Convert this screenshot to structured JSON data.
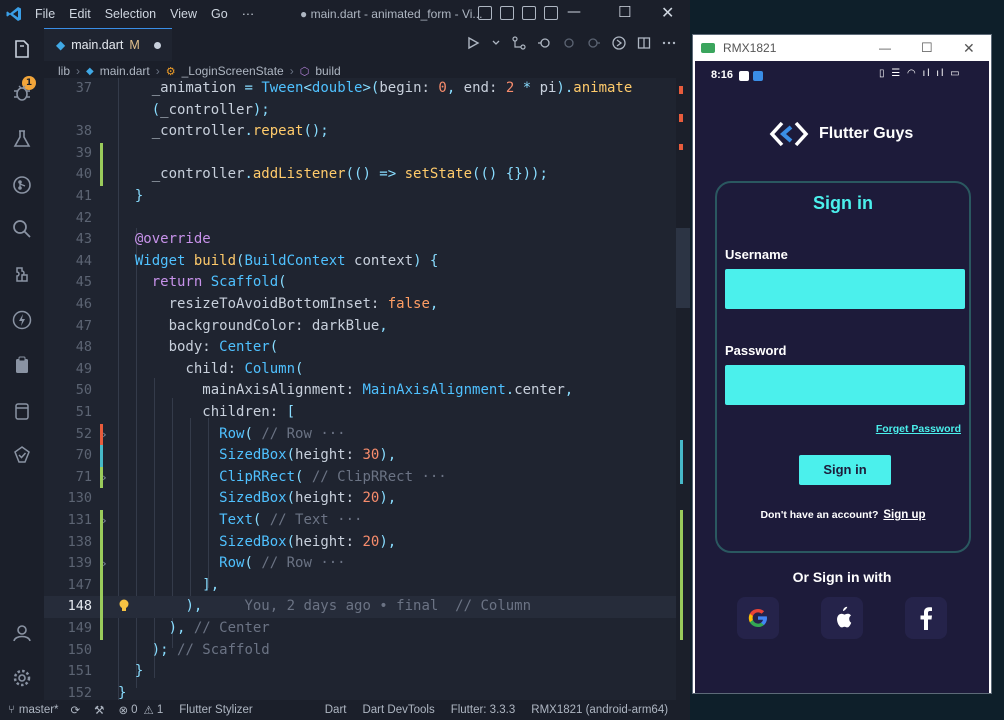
{
  "vscode": {
    "menu": [
      "File",
      "Edit",
      "Selection",
      "View",
      "Go",
      "···"
    ],
    "window_title": "● main.dart - animated_form - Vi...",
    "tab": {
      "name": "main.dart",
      "status": "M"
    },
    "breadcrumb": [
      "lib",
      "main.dart",
      "_LoginScreenState",
      "build"
    ],
    "blame_hint": "You, 2 days ago • final",
    "blame_comment": "// Column",
    "status": {
      "branch": "master*",
      "errors": "0",
      "warnings": "1",
      "stylizer": "Flutter Stylizer",
      "language": "Dart",
      "devtools": "Dart DevTools",
      "flutter": "Flutter: 3.3.3",
      "device": "RMX1821 (android-arm64)"
    },
    "lines": [
      {
        "n": "37",
        "tokens": [
          [
            "",
            "    "
          ],
          [
            "prop",
            "_animation"
          ],
          [
            "p",
            " = "
          ],
          [
            "t",
            "Tween"
          ],
          [
            "p",
            "<"
          ],
          [
            "t",
            "double"
          ],
          [
            "p",
            ">"
          ],
          [
            "p",
            "("
          ],
          [
            "prop",
            "begin: "
          ],
          [
            "n",
            "0"
          ],
          [
            "p",
            ", "
          ],
          [
            "prop",
            "end: "
          ],
          [
            "n",
            "2"
          ],
          [
            "p",
            " * "
          ],
          [
            "prop",
            "pi"
          ],
          [
            "p",
            ")."
          ],
          [
            "f",
            "animate"
          ]
        ]
      },
      {
        "n": "",
        "tokens": [
          [
            "",
            "    "
          ],
          [
            "p",
            "("
          ],
          [
            "prop",
            "_controller"
          ],
          [
            "p",
            ");"
          ]
        ]
      },
      {
        "n": "38",
        "tokens": [
          [
            "",
            "    "
          ],
          [
            "prop",
            "_controller"
          ],
          [
            "p",
            "."
          ],
          [
            "f",
            "repeat"
          ],
          [
            "p",
            "();"
          ]
        ]
      },
      {
        "n": "39",
        "tokens": []
      },
      {
        "n": "40",
        "tokens": [
          [
            "",
            "    "
          ],
          [
            "prop",
            "_controller"
          ],
          [
            "p",
            "."
          ],
          [
            "f",
            "addListener"
          ],
          [
            "p",
            "(() => "
          ],
          [
            "f",
            "setState"
          ],
          [
            "p",
            "(() {}));"
          ]
        ]
      },
      {
        "n": "41",
        "tokens": [
          [
            "",
            "  "
          ],
          [
            "p",
            "}"
          ]
        ]
      },
      {
        "n": "42",
        "tokens": []
      },
      {
        "n": "43",
        "tokens": [
          [
            "",
            "  "
          ],
          [
            "k",
            "@override"
          ]
        ]
      },
      {
        "n": "44",
        "tokens": [
          [
            "",
            "  "
          ],
          [
            "t",
            "Widget"
          ],
          [
            "prop",
            " "
          ],
          [
            "f",
            "build"
          ],
          [
            "p",
            "("
          ],
          [
            "t",
            "BuildContext"
          ],
          [
            "prop",
            " context"
          ],
          [
            "p",
            ") {"
          ]
        ]
      },
      {
        "n": "45",
        "tokens": [
          [
            "",
            "    "
          ],
          [
            "k",
            "return"
          ],
          [
            "prop",
            " "
          ],
          [
            "t",
            "Scaffold"
          ],
          [
            "p",
            "("
          ]
        ]
      },
      {
        "n": "46",
        "tokens": [
          [
            "",
            "      "
          ],
          [
            "prop",
            "resizeToAvoidBottomInset: "
          ],
          [
            "kw",
            "false"
          ],
          [
            "p",
            ","
          ]
        ]
      },
      {
        "n": "47",
        "tokens": [
          [
            "",
            "      "
          ],
          [
            "prop",
            "backgroundColor: darkBlue"
          ],
          [
            "p",
            ","
          ]
        ]
      },
      {
        "n": "48",
        "tokens": [
          [
            "",
            "      "
          ],
          [
            "prop",
            "body: "
          ],
          [
            "t",
            "Center"
          ],
          [
            "p",
            "("
          ]
        ]
      },
      {
        "n": "49",
        "tokens": [
          [
            "",
            "        "
          ],
          [
            "prop",
            "child: "
          ],
          [
            "t",
            "Column"
          ],
          [
            "p",
            "("
          ]
        ]
      },
      {
        "n": "50",
        "tokens": [
          [
            "",
            "          "
          ],
          [
            "prop",
            "mainAxisAlignment: "
          ],
          [
            "t",
            "MainAxisAlignment"
          ],
          [
            "p",
            "."
          ],
          [
            "prop",
            "center"
          ],
          [
            "p",
            ","
          ]
        ]
      },
      {
        "n": "51",
        "tokens": [
          [
            "",
            "          "
          ],
          [
            "prop",
            "children: "
          ],
          [
            "p",
            "["
          ]
        ]
      },
      {
        "n": "52",
        "fold": true,
        "tokens": [
          [
            "",
            "            "
          ],
          [
            "t",
            "Row"
          ],
          [
            "p",
            "( "
          ],
          [
            "c",
            "// Row ···"
          ]
        ]
      },
      {
        "n": "70",
        "tokens": [
          [
            "",
            "            "
          ],
          [
            "t",
            "SizedBox"
          ],
          [
            "p",
            "("
          ],
          [
            "prop",
            "height: "
          ],
          [
            "n",
            "30"
          ],
          [
            "p",
            "),"
          ]
        ]
      },
      {
        "n": "71",
        "fold": true,
        "tokens": [
          [
            "",
            "            "
          ],
          [
            "t",
            "ClipRRect"
          ],
          [
            "p",
            "( "
          ],
          [
            "c",
            "// ClipRRect ···"
          ]
        ]
      },
      {
        "n": "130",
        "tokens": [
          [
            "",
            "            "
          ],
          [
            "t",
            "SizedBox"
          ],
          [
            "p",
            "("
          ],
          [
            "prop",
            "height: "
          ],
          [
            "n",
            "20"
          ],
          [
            "p",
            "),"
          ]
        ]
      },
      {
        "n": "131",
        "fold": true,
        "tokens": [
          [
            "",
            "            "
          ],
          [
            "t",
            "Text"
          ],
          [
            "p",
            "( "
          ],
          [
            "c",
            "// Text ···"
          ]
        ]
      },
      {
        "n": "138",
        "tokens": [
          [
            "",
            "            "
          ],
          [
            "t",
            "SizedBox"
          ],
          [
            "p",
            "("
          ],
          [
            "prop",
            "height: "
          ],
          [
            "n",
            "20"
          ],
          [
            "p",
            "),"
          ]
        ]
      },
      {
        "n": "139",
        "fold": true,
        "tokens": [
          [
            "",
            "            "
          ],
          [
            "t",
            "Row"
          ],
          [
            "p",
            "( "
          ],
          [
            "c",
            "// Row ···"
          ]
        ]
      },
      {
        "n": "147",
        "tokens": [
          [
            "",
            "          "
          ],
          [
            "p",
            "],"
          ]
        ]
      },
      {
        "n": "148",
        "current": true,
        "tokens": [
          [
            "",
            "        "
          ],
          [
            "p",
            "),"
          ]
        ]
      },
      {
        "n": "149",
        "tokens": [
          [
            "",
            "      "
          ],
          [
            "p",
            "), "
          ],
          [
            "c",
            "// Center"
          ]
        ]
      },
      {
        "n": "150",
        "tokens": [
          [
            "",
            "    "
          ],
          [
            "p",
            "); "
          ],
          [
            "c",
            "// Scaffold"
          ]
        ]
      },
      {
        "n": "151",
        "tokens": [
          [
            "",
            "  "
          ],
          [
            "p",
            "}"
          ]
        ]
      },
      {
        "n": "152",
        "tokens": [
          [
            "p",
            "}"
          ]
        ]
      }
    ]
  },
  "emulator": {
    "title": "RMX1821",
    "time": "8:16",
    "app": {
      "brand": "Flutter Guys",
      "heading": "Sign in",
      "username_label": "Username",
      "password_label": "Password",
      "forgot_link": "Forget Password",
      "signin_button": "Sign in",
      "no_account": "Don't have an account?",
      "signup_link": "Sign up",
      "or_signin": "Or Sign in with"
    }
  },
  "colors": {
    "accent_cyan": "#4bf0ec",
    "phone_bg": "#1d1b3a",
    "editor_bg": "#1f2430"
  }
}
